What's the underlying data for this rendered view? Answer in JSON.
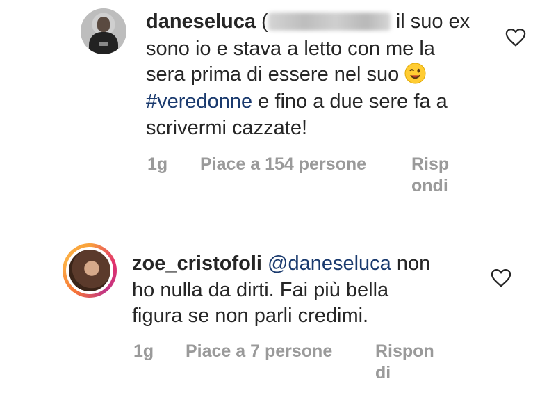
{
  "comments": [
    {
      "username": "daneseluca",
      "open_paren": "(",
      "line1_rest": " il suo ex",
      "line2": "sono io e stava a letto con me la",
      "line3": "sera prima di essere nel suo ",
      "emoji": "winking-face",
      "hashtag": "#veredonne",
      "line4_rest": " e fino a due sere fa a",
      "line5": "scrivermi cazzate!",
      "time": "1g",
      "likes": "Piace a 154 persone",
      "reply_line1": "Risp",
      "reply_line2": "ondi"
    },
    {
      "username": "zoe_cristofoli",
      "mention": "@daneseluca",
      "line1_rest": " non",
      "line2": "ho nulla da dirti. Fai più bella",
      "line3": "figura se non parli credimi.",
      "time": "1g",
      "likes": "Piace a 7 persone",
      "reply_line1": "Rispon",
      "reply_line2": "di"
    }
  ],
  "icons": {
    "like": "heart-outline-icon"
  },
  "colors": {
    "text": "#262626",
    "meta": "#9a9a9a",
    "link": "#1a3a6e"
  }
}
